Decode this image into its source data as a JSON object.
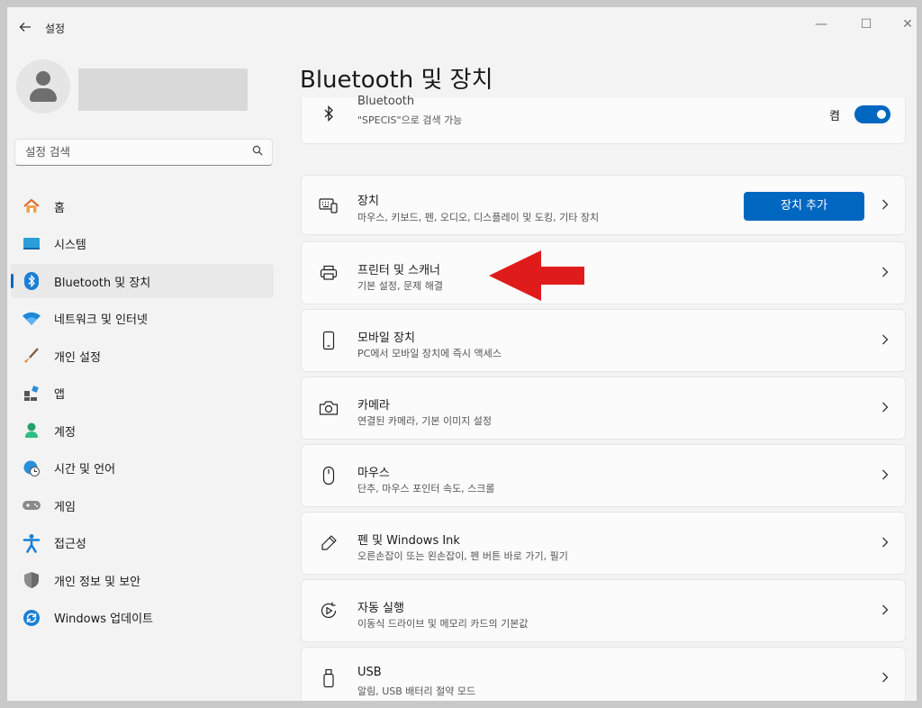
{
  "app": {
    "title": "설정"
  },
  "window_controls": {
    "minimize": "—",
    "maximize": "☐",
    "close": "✕"
  },
  "search": {
    "placeholder": "설정 검색"
  },
  "nav": {
    "items": [
      {
        "label": "홈",
        "icon": "home-icon"
      },
      {
        "label": "시스템",
        "icon": "system-icon"
      },
      {
        "label": "Bluetooth 및 장치",
        "icon": "bluetooth-icon",
        "selected": true
      },
      {
        "label": "네트워크 및 인터넷",
        "icon": "wifi-icon"
      },
      {
        "label": "개인 설정",
        "icon": "brush-icon"
      },
      {
        "label": "앱",
        "icon": "apps-icon"
      },
      {
        "label": "계정",
        "icon": "account-icon"
      },
      {
        "label": "시간 및 언어",
        "icon": "globe-clock-icon"
      },
      {
        "label": "게임",
        "icon": "gamepad-icon"
      },
      {
        "label": "접근성",
        "icon": "accessibility-icon"
      },
      {
        "label": "개인 정보 및 보안",
        "icon": "shield-icon"
      },
      {
        "label": "Windows 업데이트",
        "icon": "update-icon"
      }
    ]
  },
  "page": {
    "title": "Bluetooth 및 장치"
  },
  "bluetooth": {
    "title": "Bluetooth",
    "subtitle": "\"SPECIS\"으로 검색 가능",
    "state": "켬",
    "on": true
  },
  "cards": [
    {
      "title": "장치",
      "subtitle": "마우스, 키보드, 펜, 오디오, 디스플레이 및 도킹, 기타 장치",
      "icon": "keyboard-icon",
      "button": "장치 추가"
    },
    {
      "title": "프린터 및 스캐너",
      "subtitle": "기본 설정, 문제 해결",
      "icon": "printer-icon"
    },
    {
      "title": "모바일 장치",
      "subtitle": "PC에서 모바일 장치에 즉시 액세스",
      "icon": "phone-icon"
    },
    {
      "title": "카메라",
      "subtitle": "연결된 카메라, 기본 이미지 설정",
      "icon": "camera-icon"
    },
    {
      "title": "마우스",
      "subtitle": "단추, 마우스 포인터 속도, 스크롤",
      "icon": "mouse-icon"
    },
    {
      "title": "펜 및 Windows Ink",
      "subtitle": "오른손잡이 또는 왼손잡이, 펜 버튼 바로 가기, 필기",
      "icon": "pen-icon"
    },
    {
      "title": "자동 실행",
      "subtitle": "이동식 드라이브 및 메모리 카드의 기본값",
      "icon": "autoplay-icon"
    },
    {
      "title": "USB",
      "subtitle": "알림, USB 배터리 절약 모드",
      "icon": "usb-icon"
    }
  ],
  "colors": {
    "accent": "#0067c0",
    "annotation_arrow": "#e01b1b"
  }
}
